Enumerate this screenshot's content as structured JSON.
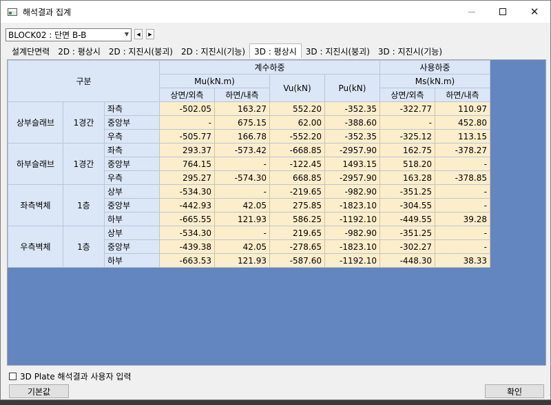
{
  "window": {
    "title": "해석결과 집계",
    "controls": {
      "minimize": "—",
      "close": "✕"
    }
  },
  "block_select": {
    "value": "BLOCK02 : 단면 B-B",
    "prev": "◀",
    "next": "▶"
  },
  "tabs": [
    {
      "label": "설계단면력",
      "active": false
    },
    {
      "label": "2D : 평상시",
      "active": false
    },
    {
      "label": "2D : 지진시(붕괴)",
      "active": false
    },
    {
      "label": "2D : 지진시(기능)",
      "active": false
    },
    {
      "label": "3D : 평상시",
      "active": true
    },
    {
      "label": "3D : 지진시(붕괴)",
      "active": false
    },
    {
      "label": "3D : 지진시(기능)",
      "active": false
    }
  ],
  "table": {
    "header": {
      "gubun": "구분",
      "design_load": "계수하중",
      "service_load": "사용하중",
      "mu": "Mu(kN.m)",
      "vu": "Vu(kN)",
      "pu": "Pu(kN)",
      "ms": "Ms(kN.m)",
      "mu_top": "상면/외측",
      "mu_bot": "하면/내측",
      "ms_top": "상면/외측",
      "ms_bot": "하면/내측"
    },
    "groups": [
      {
        "member": "상부슬래브",
        "level": "1경간",
        "rows": [
          {
            "pos": "좌측",
            "mu_top": "-502.05",
            "mu_bot": "163.27",
            "vu": "552.20",
            "pu": "-352.35",
            "ms_top": "-322.77",
            "ms_bot": "110.97"
          },
          {
            "pos": "중앙부",
            "mu_top": "-",
            "mu_bot": "675.15",
            "vu": "62.00",
            "pu": "-388.60",
            "ms_top": "-",
            "ms_bot": "452.80"
          },
          {
            "pos": "우측",
            "mu_top": "-505.77",
            "mu_bot": "166.78",
            "vu": "-552.20",
            "pu": "-352.35",
            "ms_top": "-325.12",
            "ms_bot": "113.15"
          }
        ]
      },
      {
        "member": "하부슬래브",
        "level": "1경간",
        "rows": [
          {
            "pos": "좌측",
            "mu_top": "293.37",
            "mu_bot": "-573.42",
            "vu": "-668.85",
            "pu": "-2957.90",
            "ms_top": "162.75",
            "ms_bot": "-378.27"
          },
          {
            "pos": "중앙부",
            "mu_top": "764.15",
            "mu_bot": "-",
            "vu": "-122.45",
            "pu": "1493.15",
            "ms_top": "518.20",
            "ms_bot": "-"
          },
          {
            "pos": "우측",
            "mu_top": "295.27",
            "mu_bot": "-574.30",
            "vu": "668.85",
            "pu": "-2957.90",
            "ms_top": "163.28",
            "ms_bot": "-378.85"
          }
        ]
      },
      {
        "member": "좌측벽체",
        "level": "1층",
        "rows": [
          {
            "pos": "상부",
            "mu_top": "-534.30",
            "mu_bot": "-",
            "vu": "-219.65",
            "pu": "-982.90",
            "ms_top": "-351.25",
            "ms_bot": "-"
          },
          {
            "pos": "중앙부",
            "mu_top": "-442.93",
            "mu_bot": "42.05",
            "vu": "275.85",
            "pu": "-1823.10",
            "ms_top": "-304.55",
            "ms_bot": "-"
          },
          {
            "pos": "하부",
            "mu_top": "-665.55",
            "mu_bot": "121.93",
            "vu": "586.25",
            "pu": "-1192.10",
            "ms_top": "-449.55",
            "ms_bot": "39.28"
          }
        ]
      },
      {
        "member": "우측벽체",
        "level": "1층",
        "rows": [
          {
            "pos": "상부",
            "mu_top": "-534.30",
            "mu_bot": "-",
            "vu": "219.65",
            "pu": "-982.90",
            "ms_top": "-351.25",
            "ms_bot": "-"
          },
          {
            "pos": "중앙부",
            "mu_top": "-439.38",
            "mu_bot": "42.05",
            "vu": "-278.65",
            "pu": "-1823.10",
            "ms_top": "-302.27",
            "ms_bot": "-"
          },
          {
            "pos": "하부",
            "mu_top": "-663.53",
            "mu_bot": "121.93",
            "vu": "-587.60",
            "pu": "-1192.10",
            "ms_top": "-448.30",
            "ms_bot": "38.33"
          }
        ]
      }
    ]
  },
  "footer": {
    "user_input_label": "3D Plate 해석결과 사용자 입력",
    "user_input_checked": false,
    "default_button": "기본값",
    "ok_button": "확인"
  },
  "colors": {
    "grid_background": "#6486c0",
    "header_cell": "#dbe7f6",
    "value_cell": "#fdeecb"
  }
}
